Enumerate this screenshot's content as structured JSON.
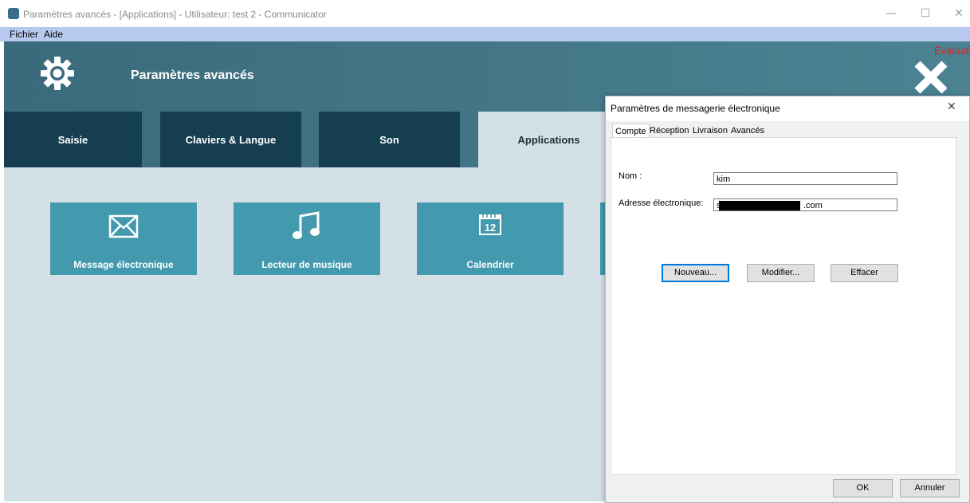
{
  "window": {
    "title": "Paramètres avancés - [Applications] - Utilisateur: test 2 - Communicator",
    "controls": {
      "minimize": "—",
      "maximize": "☐",
      "close": "✕"
    }
  },
  "menu": {
    "items": [
      "Fichier",
      "Aide"
    ]
  },
  "header": {
    "title": "Paramètres avancés",
    "evaluation_label": "Évaluati",
    "icons": {
      "settings": "gear-icon",
      "close": "close-x-icon"
    }
  },
  "tabs": [
    {
      "label": "Saisie",
      "active": false
    },
    {
      "label": "Claviers & Langue",
      "active": false
    },
    {
      "label": "Son",
      "active": false
    },
    {
      "label": "Applications",
      "active": true
    }
  ],
  "tiles": [
    {
      "label": "Message électronique",
      "icon": "envelope-icon"
    },
    {
      "label": "Lecteur de musique",
      "icon": "music-note-icon"
    },
    {
      "label": "Calendrier",
      "icon": "calendar-icon",
      "icon_text": "12"
    }
  ],
  "dialog": {
    "title": "Paramètres de messagerie électronique",
    "close": "✕",
    "tabs": [
      {
        "label": "Compte",
        "active": true
      },
      {
        "label": "Réception",
        "active": false
      },
      {
        "label": "Livraison",
        "active": false
      },
      {
        "label": "Avancés",
        "active": false
      }
    ],
    "fields": {
      "name_label": "Nom :",
      "name_value": "kim",
      "email_label": "Adresse électronique:",
      "email_prefix": "s",
      "email_suffix": ".com"
    },
    "buttons": {
      "new": "Nouveau...",
      "modify": "Modifier...",
      "delete": "Effacer"
    },
    "footer": {
      "ok": "OK",
      "cancel": "Annuler"
    }
  },
  "colors": {
    "header": "#3a6a7b",
    "tab_dark": "#153e51",
    "tile": "#4399ad",
    "content_bg": "#d3e0e5",
    "menubar": "#b7c9ef",
    "evaluation": "#e02020"
  }
}
